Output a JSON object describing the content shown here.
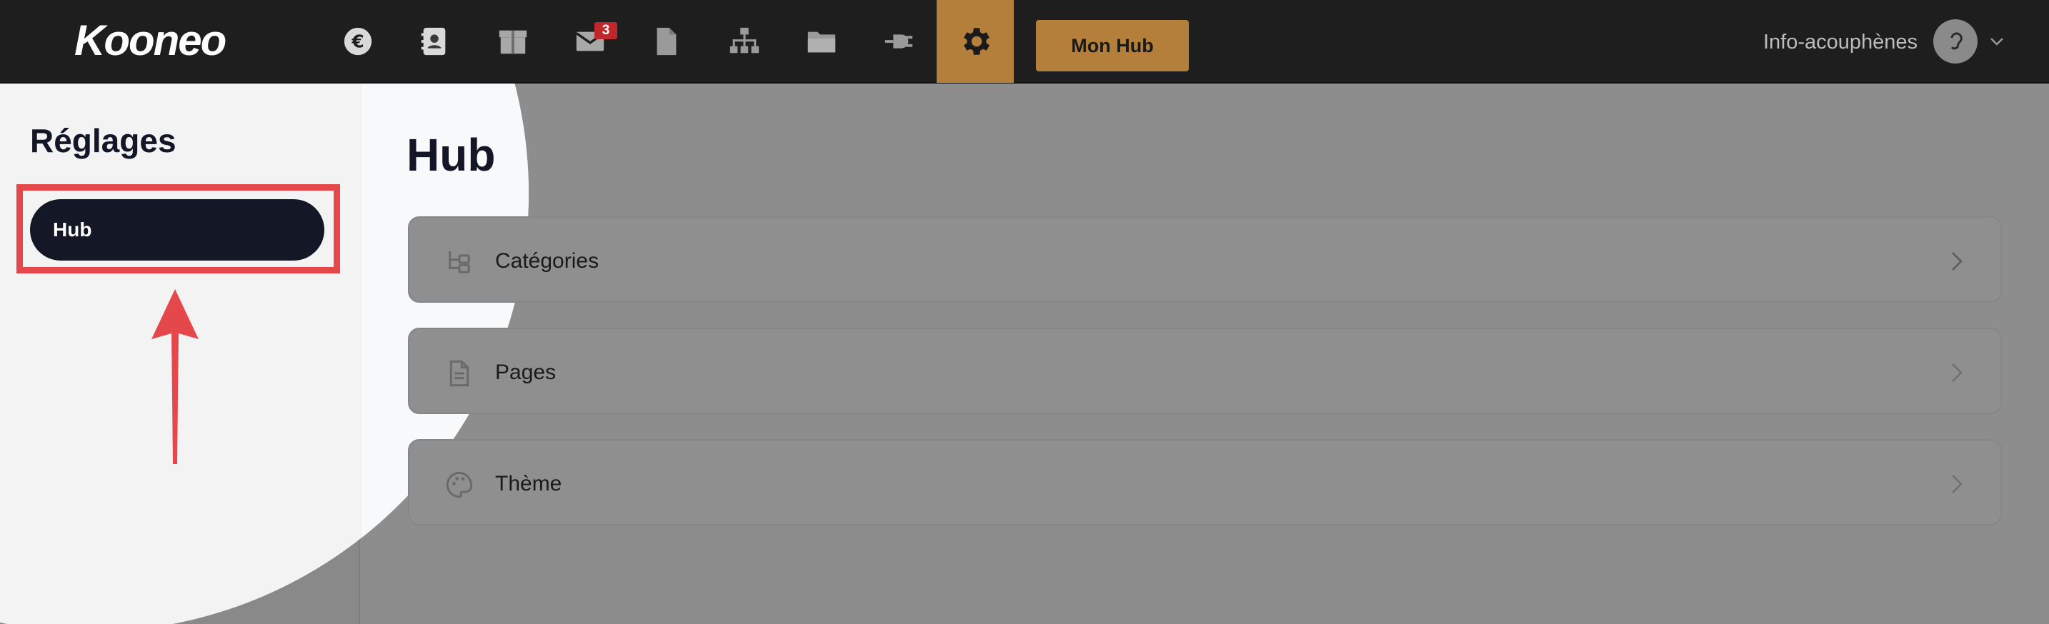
{
  "header": {
    "logo": "Kooneo",
    "nav_icons": [
      "euro-icon",
      "contacts-icon",
      "box-icon",
      "mail-icon",
      "file-icon",
      "sitemap-icon",
      "folder-icon",
      "plug-icon"
    ],
    "mail_badge": "3",
    "active_icon": "gear-icon",
    "mon_hub_label": "Mon Hub",
    "username": "Info-acouphènes"
  },
  "sidebar": {
    "title": "Réglages",
    "items": [
      {
        "label": "Hub",
        "active": true
      }
    ]
  },
  "main": {
    "title": "Hub",
    "cards": [
      {
        "label": "Catégories",
        "icon": "tree-icon"
      },
      {
        "label": "Pages",
        "icon": "document-icon"
      },
      {
        "label": "Thème",
        "icon": "palette-icon"
      }
    ]
  },
  "colors": {
    "topbar": "#1e1e1e",
    "accent": "#b47f3a",
    "sidebar_active": "#131726",
    "highlight": "#e5484b",
    "badge": "#c0272d"
  }
}
